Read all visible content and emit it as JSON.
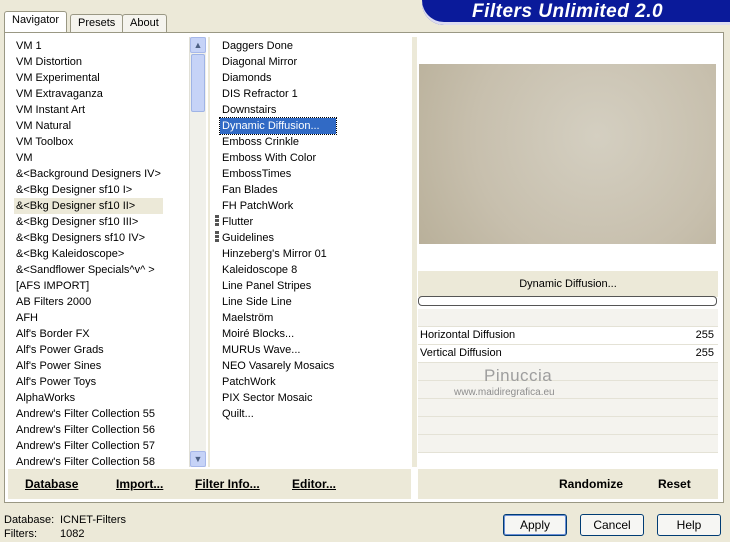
{
  "tabs": [
    "Navigator",
    "Presets",
    "About"
  ],
  "banner": "Filters Unlimited 2.0",
  "categories": [
    {
      "label": "VM 1"
    },
    {
      "label": "VM Distortion"
    },
    {
      "label": "VM Experimental"
    },
    {
      "label": "VM Extravaganza"
    },
    {
      "label": "VM Instant Art"
    },
    {
      "label": "VM Natural"
    },
    {
      "label": "VM Toolbox"
    },
    {
      "label": "VM"
    },
    {
      "label": "&<Background Designers IV>"
    },
    {
      "label": "&<Bkg Designer sf10 I>"
    },
    {
      "label": "&<Bkg Designer sf10 II>",
      "selected": true
    },
    {
      "label": "&<Bkg Designer sf10 III>"
    },
    {
      "label": "&<Bkg Designers sf10 IV>"
    },
    {
      "label": "&<Bkg Kaleidoscope>"
    },
    {
      "label": "&<Sandflower Specials^v^ >"
    },
    {
      "label": "[AFS IMPORT]"
    },
    {
      "label": "AB Filters 2000"
    },
    {
      "label": "AFH"
    },
    {
      "label": "Alf's Border FX"
    },
    {
      "label": "Alf's Power Grads"
    },
    {
      "label": "Alf's Power Sines"
    },
    {
      "label": "Alf's Power Toys"
    },
    {
      "label": "AlphaWorks"
    },
    {
      "label": "Andrew's Filter Collection 55"
    },
    {
      "label": "Andrew's Filter Collection 56"
    },
    {
      "label": "Andrew's Filter Collection 57"
    },
    {
      "label": "Andrew's Filter Collection 58"
    }
  ],
  "filters": [
    {
      "label": "Daggers Done"
    },
    {
      "label": "Diagonal Mirror"
    },
    {
      "label": "Diamonds"
    },
    {
      "label": "DIS Refractor 1"
    },
    {
      "label": "Downstairs"
    },
    {
      "label": "Dynamic Diffusion...",
      "selected": true
    },
    {
      "label": "Emboss Crinkle"
    },
    {
      "label": "Emboss With Color"
    },
    {
      "label": "EmbossTimes"
    },
    {
      "label": "Fan Blades"
    },
    {
      "label": "FH PatchWork"
    },
    {
      "label": "Flutter"
    },
    {
      "label": "Guidelines"
    },
    {
      "label": "Hinzeberg's Mirror 01"
    },
    {
      "label": "Kaleidoscope 8"
    },
    {
      "label": "Line Panel Stripes"
    },
    {
      "label": "Line Side Line"
    },
    {
      "label": "Maelström"
    },
    {
      "label": "Moiré Blocks..."
    },
    {
      "label": "MURUs Wave..."
    },
    {
      "label": "NEO Vasarely Mosaics"
    },
    {
      "label": "PatchWork"
    },
    {
      "label": "PIX Sector Mosaic"
    },
    {
      "label": "Quilt..."
    }
  ],
  "filter_panel": {
    "title": "Dynamic Diffusion...",
    "params": [
      {
        "label": "Horizontal Diffusion",
        "value": "255"
      },
      {
        "label": "Vertical Diffusion",
        "value": "255"
      }
    ]
  },
  "watermark": {
    "name": "Pinuccia",
    "url": "www.maidiregrafica.eu"
  },
  "bottom_buttons": {
    "database": "Database",
    "import": "Import...",
    "filter_info": "Filter Info...",
    "editor": "Editor...",
    "randomize": "Randomize",
    "reset": "Reset"
  },
  "status": {
    "database_label": "Database:",
    "database_value": "ICNET-Filters",
    "filters_label": "Filters:",
    "filters_value": "1082"
  },
  "dialog_buttons": {
    "apply": "Apply",
    "cancel": "Cancel",
    "help": "Help"
  },
  "colors": {
    "banner": "#0a1a9a",
    "selection": "#316ac5",
    "face": "#ece9d8"
  },
  "icons": {
    "scroll_up": "chevron-up-icon",
    "scroll_down": "chevron-down-icon"
  }
}
